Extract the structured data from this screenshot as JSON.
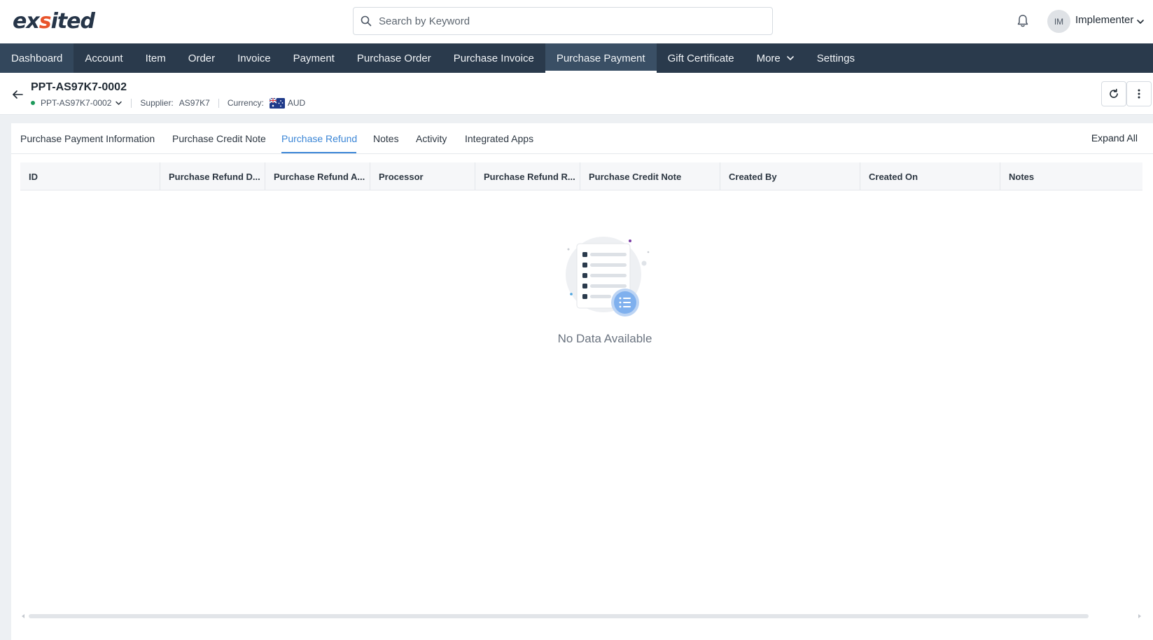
{
  "app": {
    "logo_text_1": "ex",
    "logo_text_2": "s",
    "logo_text_3": "ited"
  },
  "search": {
    "placeholder": "Search by Keyword"
  },
  "user": {
    "initials": "IM",
    "name": "Implementer"
  },
  "nav": {
    "items": [
      {
        "label": "Dashboard"
      },
      {
        "label": "Account"
      },
      {
        "label": "Item"
      },
      {
        "label": "Order"
      },
      {
        "label": "Invoice"
      },
      {
        "label": "Payment"
      },
      {
        "label": "Purchase Order"
      },
      {
        "label": "Purchase Invoice"
      },
      {
        "label": "Purchase Payment"
      },
      {
        "label": "Gift Certificate"
      },
      {
        "label": "More"
      },
      {
        "label": "Settings"
      }
    ],
    "active": "Purchase Payment"
  },
  "record": {
    "title": "PPT-AS97K7-0002",
    "id_selector": "PPT-AS97K7-0002",
    "status_color": "#1d9a5b",
    "supplier_label": "Supplier:",
    "supplier_value": "AS97K7",
    "currency_label": "Currency:",
    "currency_value": "AUD"
  },
  "tabs": {
    "items": [
      {
        "label": "Purchase Payment Information"
      },
      {
        "label": "Purchase Credit Note"
      },
      {
        "label": "Purchase Refund"
      },
      {
        "label": "Notes"
      },
      {
        "label": "Activity"
      },
      {
        "label": "Integrated Apps"
      }
    ],
    "active": "Purchase Refund",
    "expand_all": "Expand All"
  },
  "table": {
    "columns": [
      "ID",
      "Purchase Refund D...",
      "Purchase Refund A...",
      "Processor",
      "Purchase Refund R...",
      "Purchase Credit Note",
      "Created By",
      "Created On",
      "Notes"
    ],
    "rows": [],
    "empty_text": "No Data Available"
  },
  "colors": {
    "nav_bg": "#2a3a4c",
    "accent": "#3b86d6",
    "brand_orange": "#e8542b"
  }
}
